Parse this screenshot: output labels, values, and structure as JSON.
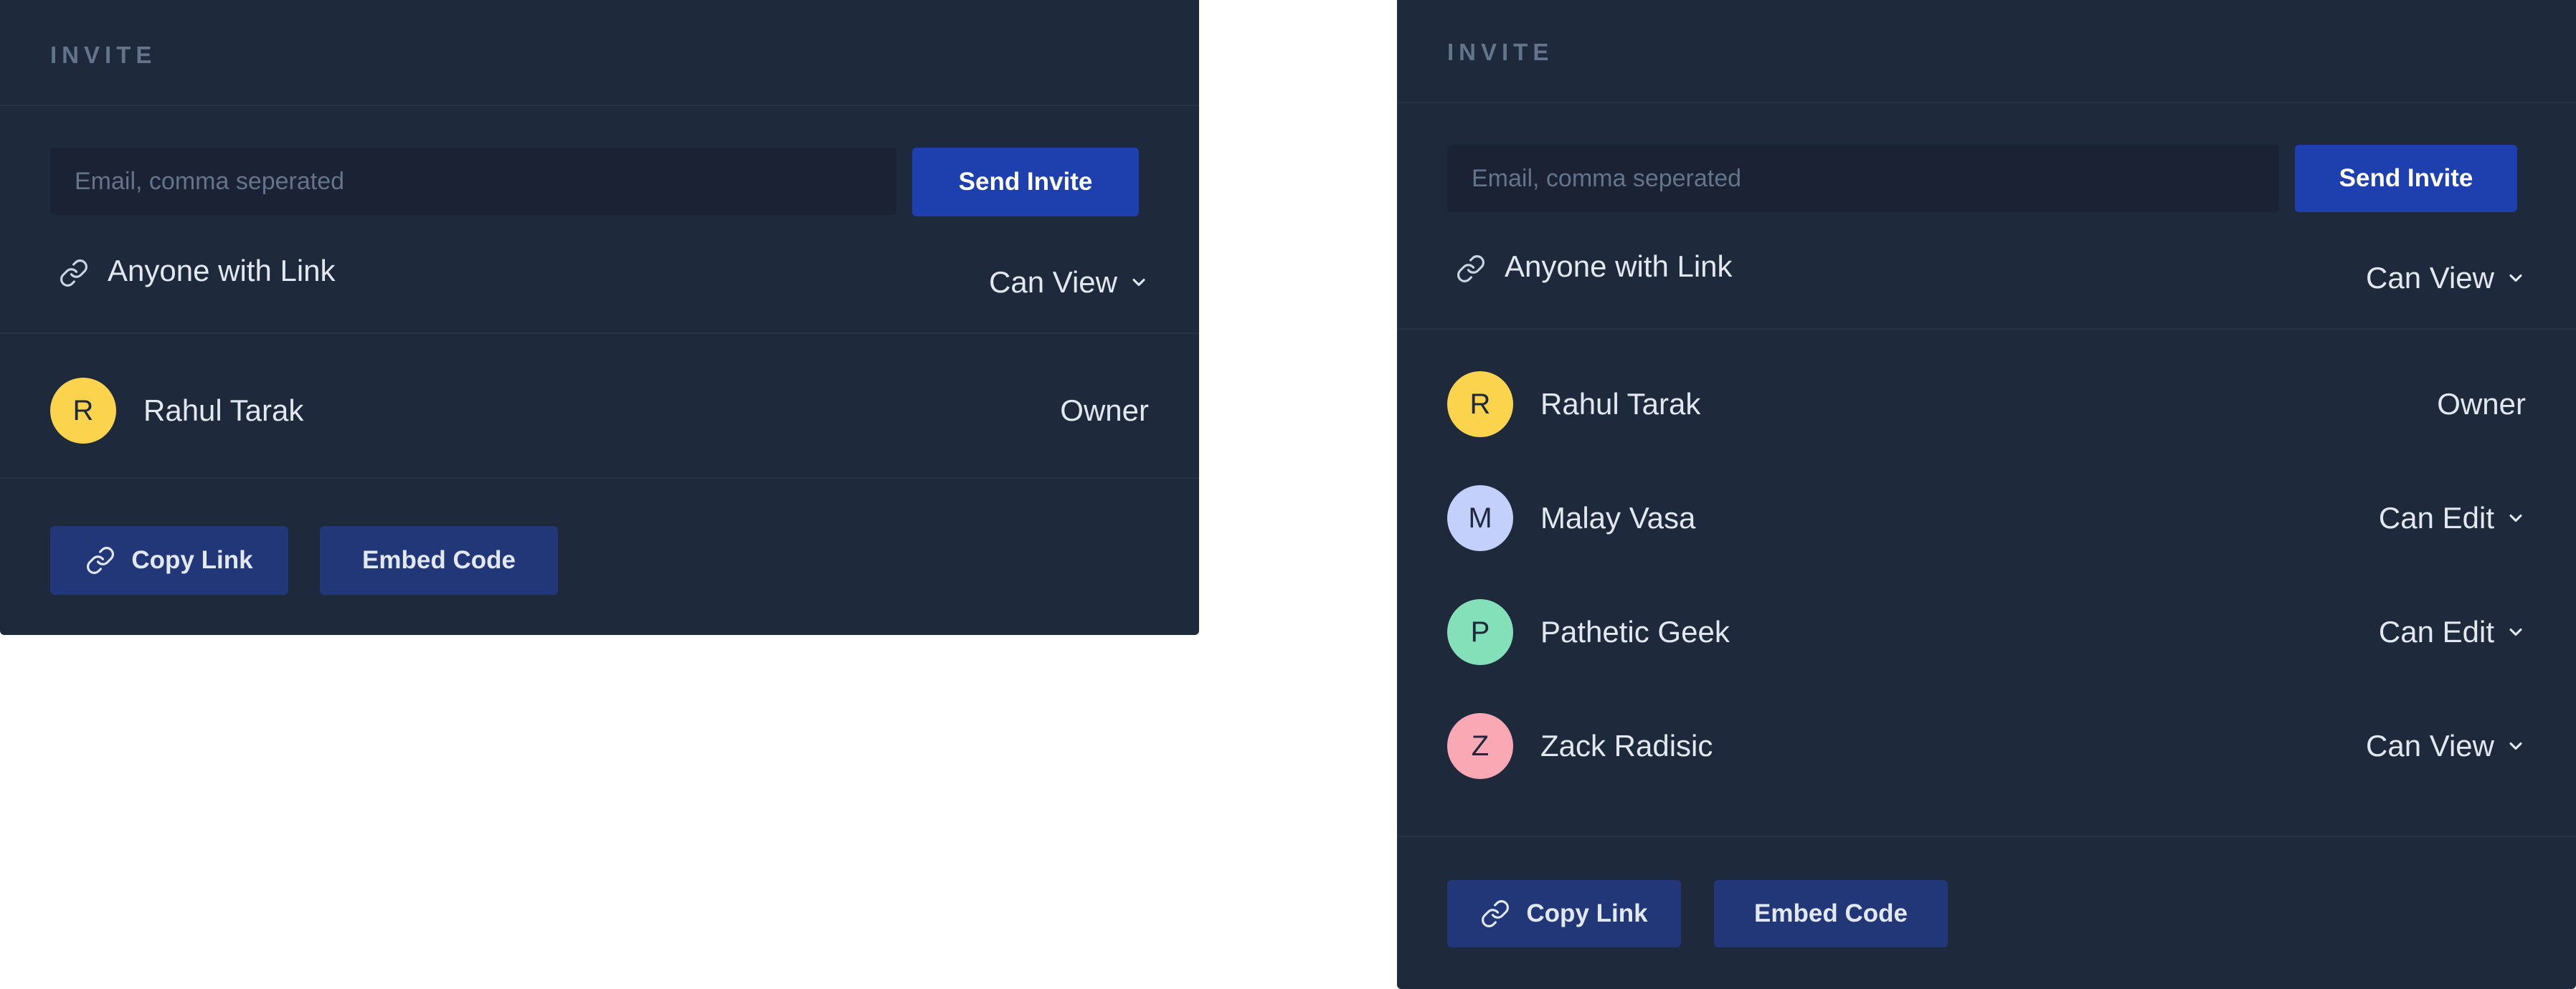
{
  "panels": [
    {
      "heading": "INVITE",
      "email_placeholder": "Email, comma seperated",
      "send_label": "Send Invite",
      "link_label": "Anyone with Link",
      "link_permission": "Can View",
      "users": [
        {
          "initial": "R",
          "name": "Rahul Tarak",
          "role": "Owner",
          "avatar_color": "#fcd34d"
        }
      ],
      "copy_label": "Copy Link",
      "embed_label": "Embed Code"
    },
    {
      "heading": "INVITE",
      "email_placeholder": "Email, comma seperated",
      "send_label": "Send Invite",
      "link_label": "Anyone with Link",
      "link_permission": "Can View",
      "users": [
        {
          "initial": "R",
          "name": "Rahul Tarak",
          "role": "Owner",
          "avatar_color": "#fcd34d"
        },
        {
          "initial": "M",
          "name": "Malay Vasa",
          "role": "Can Edit",
          "avatar_color": "#c3d0fb"
        },
        {
          "initial": "P",
          "name": "Pathetic Geek",
          "role": "Can Edit",
          "avatar_color": "#84e0b8"
        },
        {
          "initial": "Z",
          "name": "Zack Radisic",
          "role": "Can View",
          "avatar_color": "#f9a8b4"
        }
      ],
      "copy_label": "Copy Link",
      "embed_label": "Embed Code"
    }
  ]
}
